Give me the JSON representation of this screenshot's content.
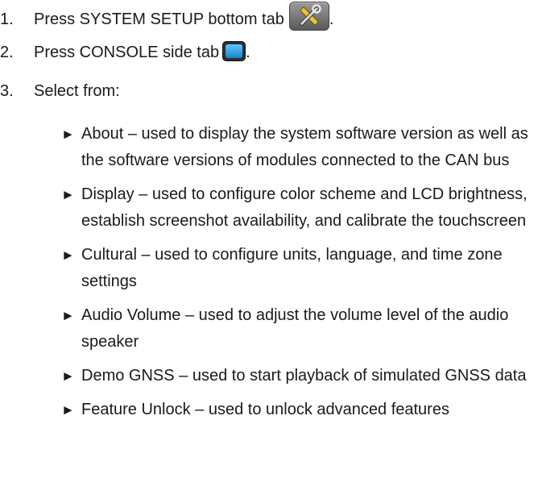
{
  "steps": [
    {
      "number": "1.",
      "text_before": "Press SYSTEM SETUP bottom tab",
      "icon": "system-setup-tools-icon",
      "text_after": "."
    },
    {
      "number": "2.",
      "text_before": "Press CONSOLE side tab",
      "icon": "console-tab-icon",
      "text_after": "."
    },
    {
      "number": "3.",
      "text_before": "Select from:"
    }
  ],
  "options": [
    {
      "name": "About",
      "desc": " – used to display the system software version as well as the software versions of modules connected to the CAN bus"
    },
    {
      "name": "Display",
      "desc": " – used to configure color scheme and LCD brightness, establish screenshot availability, and calibrate the touchscreen"
    },
    {
      "name": "Cultural",
      "desc": " – used to configure units, language, and time zone settings"
    },
    {
      "name": "Audio Volume",
      "desc": " – used to adjust the volume level of the audio speaker"
    },
    {
      "name": "Demo GNSS",
      "desc": " – used to start playback of simulated GNSS data"
    },
    {
      "name": "Feature Unlock",
      "desc": " – used to unlock advanced features"
    }
  ],
  "bullet_glyph": "►",
  "colors": {
    "text": "#1a1a1a",
    "console_icon": "#1584c9"
  }
}
